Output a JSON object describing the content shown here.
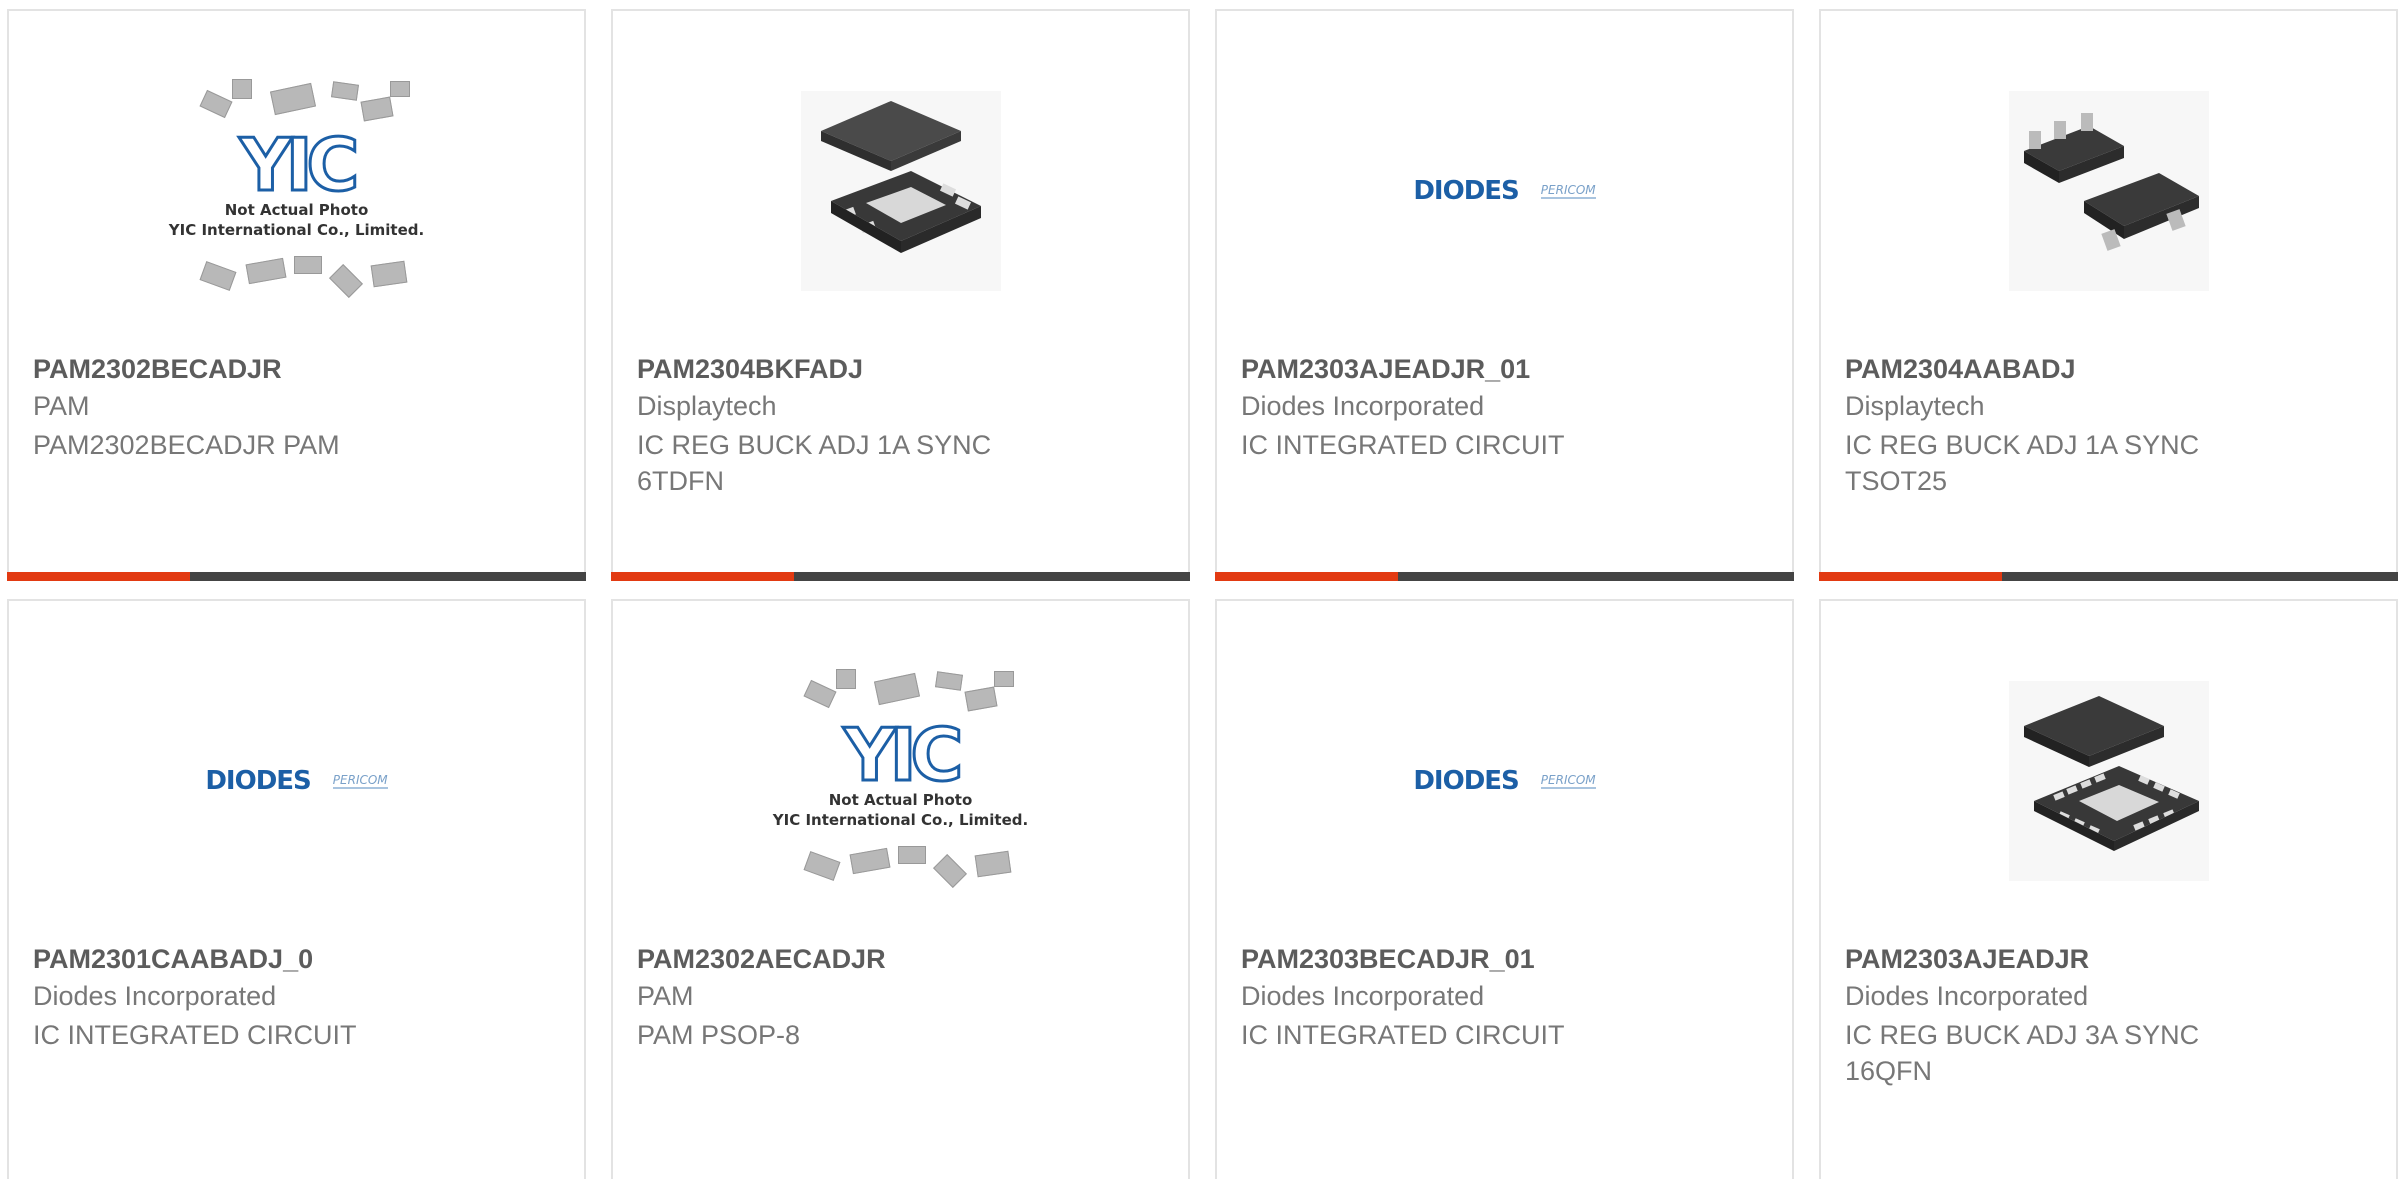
{
  "products": [
    {
      "part": "PAM2302BECADJR",
      "manufacturer": "PAM",
      "description": "PAM2302BECADJR PAM",
      "image": "yic-placeholder"
    },
    {
      "part": "PAM2304BKFADJ",
      "manufacturer": "Displaytech",
      "description": "IC REG BUCK ADJ 1A SYNC 6TDFN",
      "image": "tdfn-chip"
    },
    {
      "part": "PAM2303AJEADJR_01",
      "manufacturer": "Diodes Incorporated",
      "description": "IC INTEGRATED CIRCUIT",
      "image": "diodes-logo"
    },
    {
      "part": "PAM2304AABADJ",
      "manufacturer": "Displaytech",
      "description": "IC REG BUCK ADJ 1A SYNC TSOT25",
      "image": "tsot-chip"
    },
    {
      "part": "PAM2301CAABADJ_0",
      "manufacturer": "Diodes Incorporated",
      "description": "IC INTEGRATED CIRCUIT",
      "image": "diodes-logo"
    },
    {
      "part": "PAM2302AECADJR",
      "manufacturer": "PAM",
      "description": "PAM PSOP-8",
      "image": "yic-placeholder"
    },
    {
      "part": "PAM2303BECADJR_01",
      "manufacturer": "Diodes Incorporated",
      "description": "IC INTEGRATED CIRCUIT",
      "image": "diodes-logo"
    },
    {
      "part": "PAM2303AJEADJR",
      "manufacturer": "Diodes Incorporated",
      "description": "IC REG BUCK ADJ 3A SYNC 16QFN",
      "image": "qfn-chip"
    }
  ],
  "placeholder": {
    "logo": "YIC",
    "line1": "Not Actual Photo",
    "line2": "YIC International Co., Limited."
  },
  "diodes_logo": {
    "brand": "DIODES",
    "sub": "PERICOM"
  },
  "colors": {
    "accent": "#e23a12",
    "bar": "#444444",
    "part_text": "#5c5c5c",
    "meta_text": "#777777"
  }
}
